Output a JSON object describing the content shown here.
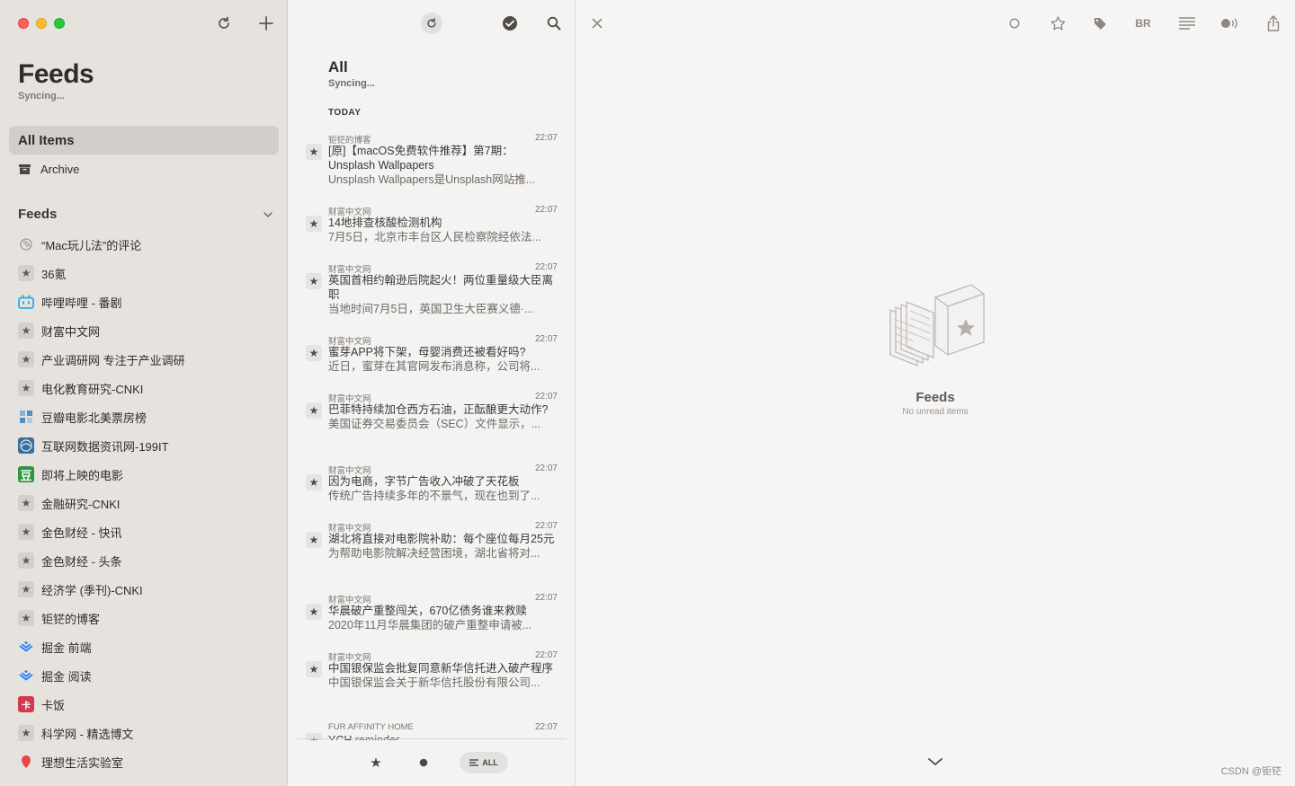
{
  "sidebar": {
    "title": "Feeds",
    "subtitle": "Syncing...",
    "nav": [
      {
        "label": "All Items",
        "icon": "inbox-icon"
      },
      {
        "label": "Archive",
        "icon": "archive-icon"
      }
    ],
    "section_label": "Feeds",
    "feeds": [
      {
        "label": "“Mac玩儿法”的评论",
        "icon": "rss-icon"
      },
      {
        "label": "36氪",
        "icon": "star-icon"
      },
      {
        "label": "哔哩哔哩 - 番剧",
        "icon": "bilibili-icon"
      },
      {
        "label": "财富中文网",
        "icon": "star-icon"
      },
      {
        "label": "产业调研网 专注于产业调研",
        "icon": "star-icon"
      },
      {
        "label": "电化教育研究-CNKI",
        "icon": "star-icon"
      },
      {
        "label": "豆瓣电影北美票房榜",
        "icon": "douban-grid-icon"
      },
      {
        "label": "互联网数据资讯网-199IT",
        "icon": "199it-icon"
      },
      {
        "label": "即将上映的电影",
        "icon": "douban-icon"
      },
      {
        "label": "金融研究-CNKI",
        "icon": "star-icon"
      },
      {
        "label": "金色财经 - 快讯",
        "icon": "star-icon"
      },
      {
        "label": "金色财经 - 头条",
        "icon": "star-icon"
      },
      {
        "label": "经济学 (季刊)-CNKI",
        "icon": "star-icon"
      },
      {
        "label": "钜铓的博客",
        "icon": "star-icon"
      },
      {
        "label": "掘金 前端",
        "icon": "juejin-icon"
      },
      {
        "label": "掘金 阅读",
        "icon": "juejin-icon"
      },
      {
        "label": "卡饭",
        "icon": "kafan-icon"
      },
      {
        "label": "科学网 - 精选博文",
        "icon": "star-icon"
      },
      {
        "label": "理想生活实验室",
        "icon": "red-pin-icon"
      }
    ]
  },
  "list": {
    "title": "All",
    "subtitle": "Syncing...",
    "section": "TODAY",
    "articles": [
      {
        "source": "钜铓的博客",
        "time": "22:07",
        "title": "[原]【macOS免费软件推荐】第7期：Unsplash Wallpapers",
        "summary": "Unsplash Wallpapers是Unsplash网站推..."
      },
      {
        "source": "财富中文网",
        "time": "22:07",
        "title": "14地排查核酸检测机构",
        "summary": "7月5日，北京市丰台区人民检察院经依法..."
      },
      {
        "source": "财富中文网",
        "time": "22:07",
        "title": "英国首相约翰逊后院起火！两位重量级大臣离职",
        "summary": "当地时间7月5日，英国卫生大臣赛义德·..."
      },
      {
        "source": "财富中文网",
        "time": "22:07",
        "title": "蜜芽APP将下架，母婴消费还被看好吗?",
        "summary": "近日，蜜芽在其官网发布消息称，公司将..."
      },
      {
        "source": "财富中文网",
        "time": "22:07",
        "title": "巴菲特持续加仓西方石油，正酝酿更大动作?",
        "summary": "美国证券交易委员会（SEC）文件显示，..."
      },
      {
        "source": "财富中文网",
        "time": "22:07",
        "title": "因为电商，字节广告收入冲破了天花板",
        "summary": "传统广告持续多年的不景气，现在也到了..."
      },
      {
        "source": "财富中文网",
        "time": "22:07",
        "title": "湖北将直接对电影院补助：每个座位每月25元",
        "summary": "为帮助电影院解决经营困境，湖北省将对..."
      },
      {
        "source": "财富中文网",
        "time": "22:07",
        "title": "华晨破产重整闯关，670亿债务谁来救赎",
        "summary": "2020年11月华晨集团的破产重整申请被..."
      },
      {
        "source": "财富中文网",
        "time": "22:07",
        "title": "中国银保监会批复同意新华信托进入破产程序",
        "summary": "中国银保监会关于新华信托股份有限公司..."
      },
      {
        "source": "FUR AFFINITY HOME",
        "time": "22:07",
        "title": "YCH reminder",
        "summary": ""
      }
    ],
    "filter_all_label": "ALL"
  },
  "detail": {
    "toolbar_br_label": "BR",
    "empty_title": "Feeds",
    "empty_subtitle": "No unread items"
  },
  "watermark": "CSDN @钜铓",
  "colors": {
    "accent_close": "#fe5f57",
    "accent_min": "#febc2e",
    "accent_max": "#28c840"
  }
}
